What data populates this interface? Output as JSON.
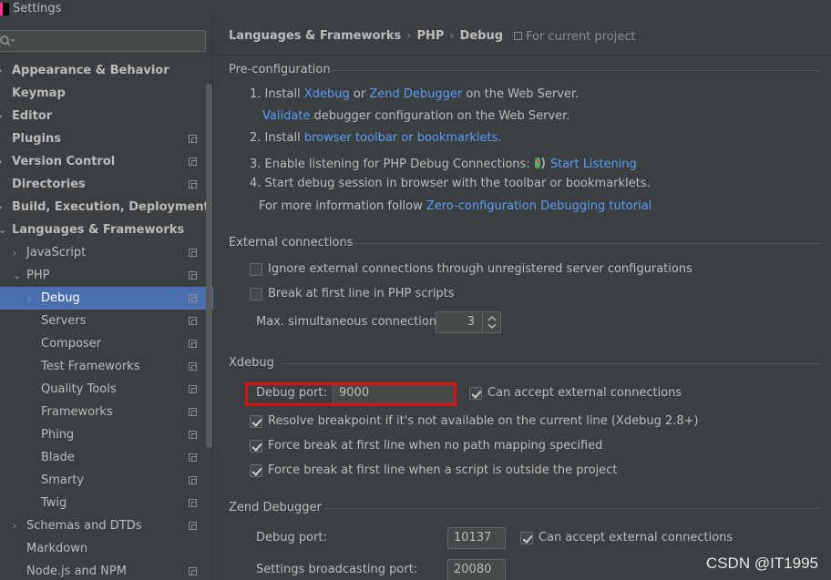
{
  "window": {
    "title": "Settings"
  },
  "sidebar": {
    "search_placeholder": "",
    "items": [
      {
        "label": "Appearance & Behavior",
        "arrow": "›",
        "project": false
      },
      {
        "label": "Keymap",
        "arrow": "",
        "project": false
      },
      {
        "label": "Editor",
        "arrow": "›",
        "project": false
      },
      {
        "label": "Plugins",
        "arrow": "",
        "project": true
      },
      {
        "label": "Version Control",
        "arrow": "›",
        "project": true
      },
      {
        "label": "Directories",
        "arrow": "",
        "project": true
      },
      {
        "label": "Build, Execution, Deployment",
        "arrow": "›",
        "project": false
      },
      {
        "label": "Languages & Frameworks",
        "arrow": "⌄",
        "project": false
      },
      {
        "label": "JavaScript",
        "arrow": "›",
        "project": true
      },
      {
        "label": "PHP",
        "arrow": "⌄",
        "project": true
      },
      {
        "label": "Debug",
        "arrow": "›",
        "project": true
      },
      {
        "label": "Servers",
        "arrow": "",
        "project": true
      },
      {
        "label": "Composer",
        "arrow": "",
        "project": true
      },
      {
        "label": "Test Frameworks",
        "arrow": "",
        "project": true
      },
      {
        "label": "Quality Tools",
        "arrow": "",
        "project": true
      },
      {
        "label": "Frameworks",
        "arrow": "",
        "project": true
      },
      {
        "label": "Phing",
        "arrow": "",
        "project": true
      },
      {
        "label": "Blade",
        "arrow": "",
        "project": true
      },
      {
        "label": "Smarty",
        "arrow": "",
        "project": true
      },
      {
        "label": "Twig",
        "arrow": "",
        "project": true
      },
      {
        "label": "Schemas and DTDs",
        "arrow": "›",
        "project": true
      },
      {
        "label": "Markdown",
        "arrow": "",
        "project": false
      },
      {
        "label": "Node.js and NPM",
        "arrow": "",
        "project": true
      }
    ]
  },
  "breadcrumb": [
    "Languages & Frameworks",
    "PHP",
    "Debug"
  ],
  "breadcrumb_sep": "›",
  "for_project": "For current project",
  "preconfig": {
    "title": "Pre-configuration",
    "step1_a": "1. Install",
    "step1_link1": "Xdebug",
    "step1_or": "or",
    "step1_link2": "Zend Debugger",
    "step1_b": "on the Web Server.",
    "step1b_link": "Validate",
    "step1b_text": "debugger configuration on the Web Server.",
    "step2_a": "2. Install",
    "step2_link": "browser toolbar or bookmarklets.",
    "step3_a": "3. Enable listening for PHP Debug Connections:",
    "step3_link": "Start Listening",
    "step4": "4. Start debug session in browser with the toolbar or bookmarklets.",
    "more_a": "For more information follow",
    "more_link": "Zero-configuration Debugging tutorial"
  },
  "external": {
    "title": "External connections",
    "ignore_label": "Ignore external connections through unregistered server configurations",
    "ignore_checked": false,
    "break_label": "Break at first line in PHP scripts",
    "break_checked": false,
    "max_label": "Max. simultaneous connections:",
    "max_value": "3"
  },
  "xdebug": {
    "title": "Xdebug",
    "port_label": "Debug port:",
    "port_value": "9000",
    "accept_label": "Can accept external connections",
    "accept_checked": true,
    "resolve_label": "Resolve breakpoint if it's not available on the current line (Xdebug 2.8+)",
    "force1_label": "Force break at first line when no path mapping specified",
    "force2_label": "Force break at first line when a script is outside the project"
  },
  "zend": {
    "title": "Zend Debugger",
    "port_label": "Debug port:",
    "port_value": "10137",
    "accept_label": "Can accept external connections",
    "broadcast_label": "Settings broadcasting port:",
    "broadcast_value": "20080"
  },
  "watermark": "CSDN @IT1995",
  "colors": {
    "link": "#589df6",
    "selection": "#4b6eaf",
    "highlight": "#e01010"
  }
}
